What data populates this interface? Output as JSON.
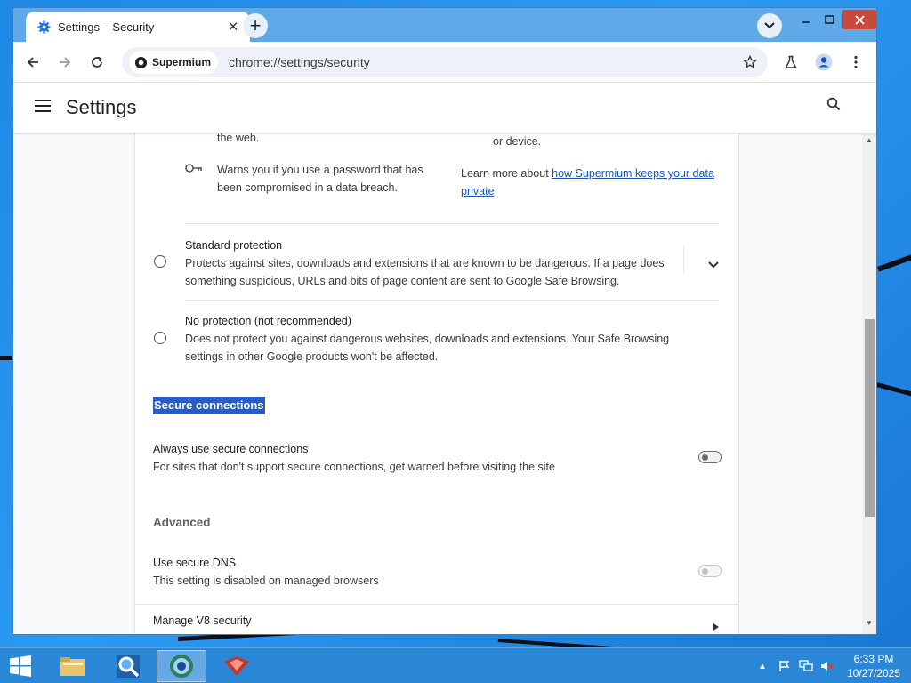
{
  "browser": {
    "tab_title": "Settings – Security",
    "site_chip": "Supermium",
    "url": "chrome://settings/security"
  },
  "settings": {
    "title": "Settings",
    "partial_text_left": "the web.",
    "partial_text_right": "or device.",
    "breach_warning": "Warns you if you use a password that has been compromised in a data breach.",
    "learn_more_prefix": "Learn more about ",
    "learn_more_link": "how Supermium keeps your data private",
    "standard": {
      "title": "Standard protection",
      "desc": "Protects against sites, downloads and extensions that are known to be dangerous. If a page does something suspicious, URLs and bits of page content are sent to Google Safe Browsing."
    },
    "noprotection": {
      "title": "No protection (not recommended)",
      "desc": "Does not protect you against dangerous websites, downloads and extensions. Your Safe Browsing settings in other Google products won't be affected."
    },
    "secure_connections_title": "Secure connections",
    "always_secure": {
      "title": "Always use secure connections",
      "desc": "For sites that don't support secure connections, get warned before visiting the site",
      "enabled": false
    },
    "advanced_title": "Advanced",
    "secure_dns": {
      "title": "Use secure DNS",
      "desc": "This setting is disabled on managed browsers",
      "enabled": false
    },
    "v8_title": "Manage V8 security"
  },
  "taskbar": {
    "time": "6:33 PM",
    "date": "10/27/2025"
  },
  "colors": {
    "accent": "#1a56b8",
    "highlight": "#2a5cc6",
    "close_button": "#c94a3c",
    "taskbar": "#2a87d8"
  }
}
